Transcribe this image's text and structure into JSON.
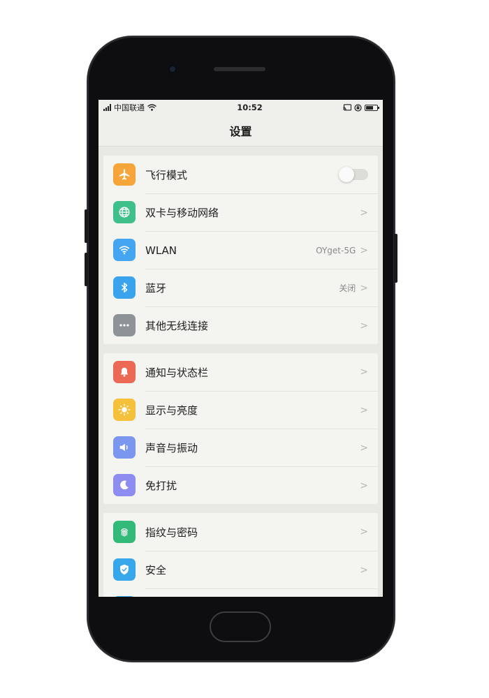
{
  "status_bar": {
    "carrier": "中国联通",
    "time": "10:52"
  },
  "header": {
    "title": "设置"
  },
  "groups": [
    {
      "items": [
        {
          "label": "飞行模式",
          "icon": "airplane-icon",
          "color": "#f5a53a",
          "toggle": "off"
        },
        {
          "label": "双卡与移动网络",
          "icon": "globe-icon",
          "color": "#3fc08a"
        },
        {
          "label": "WLAN",
          "value": "OYget-5G",
          "icon": "wifi-icon",
          "color": "#44a6f2"
        },
        {
          "label": "蓝牙",
          "value": "关闭",
          "icon": "bluetooth-icon",
          "color": "#3aa3ee"
        },
        {
          "label": "其他无线连接",
          "icon": "more-dots-icon",
          "color": "#8d9396"
        }
      ]
    },
    {
      "items": [
        {
          "label": "通知与状态栏",
          "icon": "bell-icon",
          "color": "#ec6a55"
        },
        {
          "label": "显示与亮度",
          "icon": "sun-icon",
          "color": "#f5c03a"
        },
        {
          "label": "声音与振动",
          "icon": "speaker-icon",
          "color": "#7b96ee"
        },
        {
          "label": "免打扰",
          "icon": "moon-icon",
          "color": "#8d8cf0"
        }
      ]
    },
    {
      "items": [
        {
          "label": "指纹与密码",
          "icon": "fingerprint-icon",
          "color": "#33b978"
        },
        {
          "label": "安全",
          "icon": "shield-icon",
          "color": "#37a7ec"
        }
      ]
    }
  ]
}
